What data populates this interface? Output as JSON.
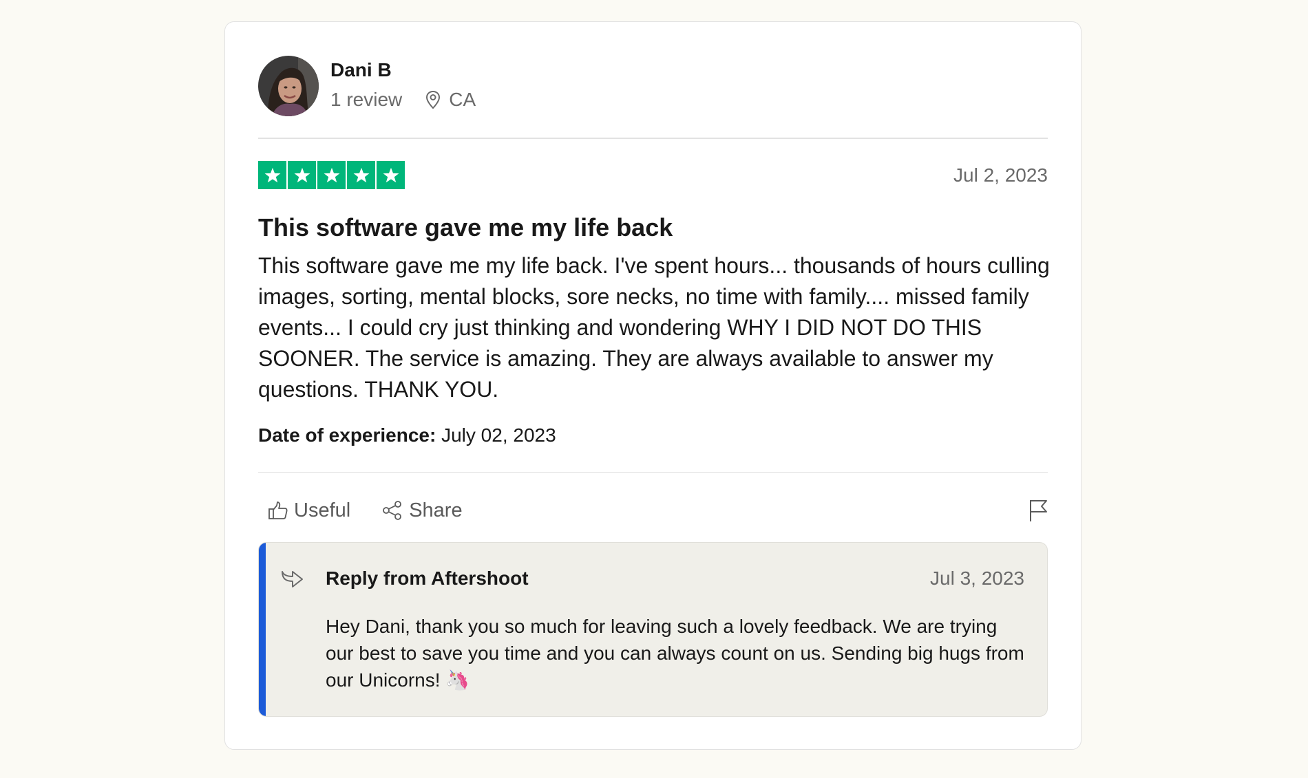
{
  "user": {
    "name": "Dani B",
    "review_count": "1 review",
    "location": "CA",
    "avatar_icon": "user-photo"
  },
  "review": {
    "rating": 5,
    "rating_max": 5,
    "star_color": "#00b67a",
    "date": "Jul 2, 2023",
    "title": "This software gave me my life back",
    "body": "This software gave me my life back. I've spent hours... thousands of hours culling images, sorting, mental blocks, sore necks, no time with family.... missed family events... I could cry just thinking and wondering WHY I DID NOT DO THIS SOONER. The service is amazing. They are always available to answer my questions. THANK YOU.",
    "experience_label": "Date of experience:",
    "experience_date": " July 02, 2023"
  },
  "actions": {
    "useful_label": "Useful",
    "share_label": "Share",
    "useful_icon": "thumbs-up-icon",
    "share_icon": "share-icon",
    "flag_icon": "flag-icon"
  },
  "reply": {
    "from": "Reply from Aftershoot",
    "date": "Jul 3, 2023",
    "text": "Hey Dani, thank you so much for leaving such a lovely feedback. We are trying our best to save you time and you can always count on us. Sending big hugs from our Unicorns! 🦄",
    "accent_color": "#1c5bd8",
    "icon": "reply-arrow-icon"
  }
}
